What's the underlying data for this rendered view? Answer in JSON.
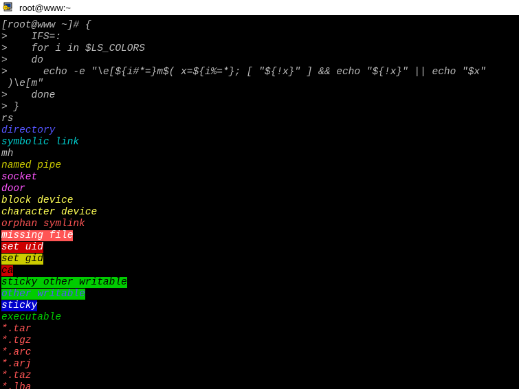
{
  "window": {
    "title": "root@www:~",
    "icon": "putty-computer-key-icon"
  },
  "palette": {
    "background": "#000000",
    "foreground": "#bbbbbb",
    "white": "#ffffff",
    "black": "#000000",
    "red": "#ff5555",
    "dark_red": "#cc0000",
    "green": "#00cc00",
    "bright_green": "#55ff55",
    "yellow": "#cccc00",
    "bright_yellow": "#ffff55",
    "blue": "#5555ff",
    "magenta": "#ff55ff",
    "cyan": "#00cdcd",
    "titlebar_bg": "#ffffff",
    "titlebar_fg": "#000000"
  },
  "terminal": {
    "lines": [
      {
        "name": "prompt-line",
        "segments": [
          {
            "text": "[root@www ~]# {",
            "fg": "#bbbbbb",
            "bg": null
          }
        ]
      },
      {
        "name": "continuation-line",
        "segments": [
          {
            "text": ">    IFS=:",
            "fg": "#bbbbbb",
            "bg": null
          }
        ]
      },
      {
        "name": "continuation-line",
        "segments": [
          {
            "text": ">    for i in $LS_COLORS",
            "fg": "#bbbbbb",
            "bg": null
          }
        ]
      },
      {
        "name": "continuation-line",
        "segments": [
          {
            "text": ">    do",
            "fg": "#bbbbbb",
            "bg": null
          }
        ]
      },
      {
        "name": "continuation-line",
        "segments": [
          {
            "text": ">      echo -e \"\\e[${i#*=}m$( x=${i%=*}; [ \"${!x}\" ] && echo \"${!x}\" || echo \"$x\"",
            "fg": "#bbbbbb",
            "bg": null
          }
        ]
      },
      {
        "name": "continuation-line",
        "segments": [
          {
            "text": " )\\e[m\"",
            "fg": "#bbbbbb",
            "bg": null
          }
        ]
      },
      {
        "name": "continuation-line",
        "segments": [
          {
            "text": ">    done",
            "fg": "#bbbbbb",
            "bg": null
          }
        ]
      },
      {
        "name": "continuation-line",
        "segments": [
          {
            "text": "> }",
            "fg": "#bbbbbb",
            "bg": null
          }
        ]
      },
      {
        "name": "ls-colors-entry",
        "segments": [
          {
            "text": "rs",
            "fg": "#bbbbbb",
            "bg": null
          }
        ]
      },
      {
        "name": "ls-colors-entry",
        "segments": [
          {
            "text": "directory",
            "fg": "#5555ff",
            "bg": null
          }
        ]
      },
      {
        "name": "ls-colors-entry",
        "segments": [
          {
            "text": "symbolic link",
            "fg": "#00cdcd",
            "bg": null
          }
        ]
      },
      {
        "name": "ls-colors-entry",
        "segments": [
          {
            "text": "mh",
            "fg": "#bbbbbb",
            "bg": null
          }
        ]
      },
      {
        "name": "ls-colors-entry",
        "segments": [
          {
            "text": "named pipe",
            "fg": "#cccc00",
            "bg": null
          }
        ]
      },
      {
        "name": "ls-colors-entry",
        "segments": [
          {
            "text": "socket",
            "fg": "#ff55ff",
            "bg": null
          }
        ]
      },
      {
        "name": "ls-colors-entry",
        "segments": [
          {
            "text": "door",
            "fg": "#ff55ff",
            "bg": null
          }
        ]
      },
      {
        "name": "ls-colors-entry",
        "segments": [
          {
            "text": "block device",
            "fg": "#ffff55",
            "bg": null
          }
        ]
      },
      {
        "name": "ls-colors-entry",
        "segments": [
          {
            "text": "character device",
            "fg": "#ffff55",
            "bg": null
          }
        ]
      },
      {
        "name": "ls-colors-entry",
        "segments": [
          {
            "text": "orphan symlink",
            "fg": "#ff5555",
            "bg": null
          }
        ]
      },
      {
        "name": "ls-colors-entry",
        "segments": [
          {
            "text": "missing file",
            "fg": "#ffffff",
            "bg": "#ff5555"
          }
        ]
      },
      {
        "name": "ls-colors-entry",
        "segments": [
          {
            "text": "set uid",
            "fg": "#ffffff",
            "bg": "#cc0000"
          }
        ]
      },
      {
        "name": "ls-colors-entry",
        "segments": [
          {
            "text": "set gid",
            "fg": "#000000",
            "bg": "#cccc00"
          }
        ]
      },
      {
        "name": "ls-colors-entry",
        "segments": [
          {
            "text": "ca",
            "fg": "#000000",
            "bg": "#cc0000"
          }
        ]
      },
      {
        "name": "ls-colors-entry",
        "segments": [
          {
            "text": "sticky other writable",
            "fg": "#000000",
            "bg": "#00cc00"
          }
        ]
      },
      {
        "name": "ls-colors-entry",
        "segments": [
          {
            "text": "other writable",
            "fg": "#5555ff",
            "bg": "#00cc00"
          }
        ]
      },
      {
        "name": "ls-colors-entry",
        "segments": [
          {
            "text": "sticky",
            "fg": "#ffffff",
            "bg": "#0000cc"
          }
        ]
      },
      {
        "name": "ls-colors-entry",
        "segments": [
          {
            "text": "executable",
            "fg": "#00cc00",
            "bg": null
          }
        ]
      },
      {
        "name": "ls-colors-entry",
        "segments": [
          {
            "text": "*.tar",
            "fg": "#ff5555",
            "bg": null
          }
        ]
      },
      {
        "name": "ls-colors-entry",
        "segments": [
          {
            "text": "*.tgz",
            "fg": "#ff5555",
            "bg": null
          }
        ]
      },
      {
        "name": "ls-colors-entry",
        "segments": [
          {
            "text": "*.arc",
            "fg": "#ff5555",
            "bg": null
          }
        ]
      },
      {
        "name": "ls-colors-entry",
        "segments": [
          {
            "text": "*.arj",
            "fg": "#ff5555",
            "bg": null
          }
        ]
      },
      {
        "name": "ls-colors-entry",
        "segments": [
          {
            "text": "*.taz",
            "fg": "#ff5555",
            "bg": null
          }
        ]
      },
      {
        "name": "ls-colors-entry",
        "segments": [
          {
            "text": "*.lha",
            "fg": "#ff5555",
            "bg": null
          }
        ]
      }
    ]
  }
}
